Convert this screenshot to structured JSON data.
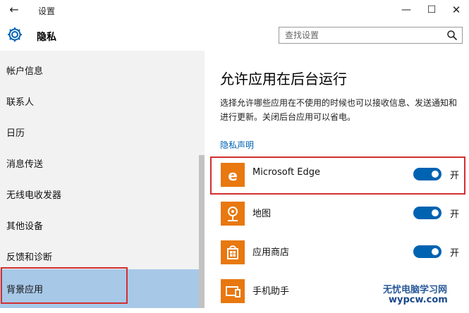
{
  "window": {
    "title": "设置",
    "back_glyph": "←",
    "min_glyph": "—",
    "max_glyph": "☐",
    "close_glyph": "✕"
  },
  "header": {
    "heading": "隐私",
    "search_placeholder": "查找设置"
  },
  "sidebar": {
    "items": [
      {
        "label": "帐户信息",
        "active": false
      },
      {
        "label": "联系人",
        "active": false
      },
      {
        "label": "日历",
        "active": false
      },
      {
        "label": "消息传送",
        "active": false
      },
      {
        "label": "无线电收发器",
        "active": false
      },
      {
        "label": "其他设备",
        "active": false
      },
      {
        "label": "反馈和诊断",
        "active": false
      },
      {
        "label": "背景应用",
        "active": true
      }
    ]
  },
  "main": {
    "title": "允许应用在后台运行",
    "description": "选择允许哪些应用在不使用的时候也可以接收信息、发送通知和进行更新。关闭后台应用可以省电。",
    "privacy_link": "隐私声明",
    "apps": [
      {
        "name": "Microsoft Edge",
        "icon": "edge-icon",
        "enabled": true,
        "state": "开"
      },
      {
        "name": "地图",
        "icon": "maps-icon",
        "enabled": true,
        "state": "开"
      },
      {
        "name": "应用商店",
        "icon": "store-icon",
        "enabled": true,
        "state": "开"
      },
      {
        "name": "手机助手",
        "icon": "phone-companion-icon",
        "enabled": null,
        "state": ""
      }
    ]
  },
  "watermark": {
    "line1": "无忧电脑学习网",
    "line2": "wypcw.com"
  },
  "colors": {
    "accent": "#0063b1",
    "app_tile": "#e8780f",
    "sidebar_bg": "#f2f2f2",
    "active_bg": "#a8c8e8",
    "highlight_box": "#d32f2f"
  }
}
